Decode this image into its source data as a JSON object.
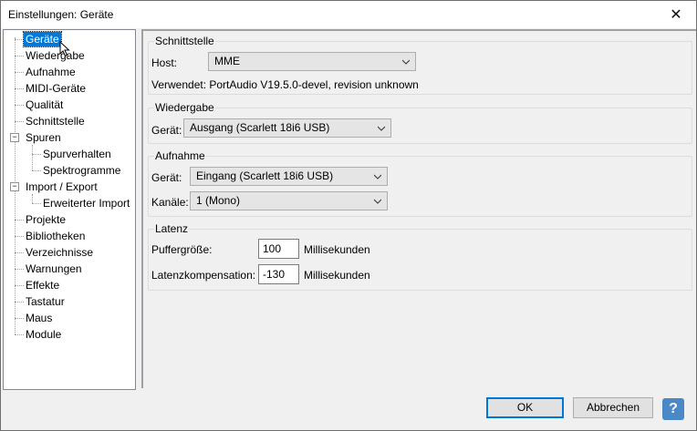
{
  "window": {
    "title": "Einstellungen: Geräte",
    "close_glyph": "✕"
  },
  "tree": {
    "items": [
      {
        "label": "Geräte"
      },
      {
        "label": "Wiedergabe"
      },
      {
        "label": "Aufnahme"
      },
      {
        "label": "MIDI-Geräte"
      },
      {
        "label": "Qualität"
      },
      {
        "label": "Schnittstelle"
      },
      {
        "label": "Spuren"
      },
      {
        "label": "Spurverhalten"
      },
      {
        "label": "Spektrogramme"
      },
      {
        "label": "Import / Export"
      },
      {
        "label": "Erweiterter Import"
      },
      {
        "label": "Projekte"
      },
      {
        "label": "Bibliotheken"
      },
      {
        "label": "Verzeichnisse"
      },
      {
        "label": "Warnungen"
      },
      {
        "label": "Effekte"
      },
      {
        "label": "Tastatur"
      },
      {
        "label": "Maus"
      },
      {
        "label": "Module"
      }
    ],
    "expander_glyph": "−"
  },
  "schnittstelle": {
    "title": "Schnittstelle",
    "host_label": "Host:",
    "host_value": "MME",
    "verwendet": "Verwendet: PortAudio V19.5.0-devel, revision unknown"
  },
  "wiedergabe": {
    "title": "Wiedergabe",
    "geraet_label": "Gerät:",
    "geraet_value": "Ausgang (Scarlett 18i6 USB)"
  },
  "aufnahme": {
    "title": "Aufnahme",
    "geraet_label": "Gerät:",
    "geraet_value": "Eingang (Scarlett 18i6 USB)",
    "kanaele_label": "Kanäle:",
    "kanaele_value": "1 (Mono)"
  },
  "latenz": {
    "title": "Latenz",
    "puffer_label": "Puffergröße:",
    "puffer_value": "100",
    "puffer_unit": "Millisekunden",
    "komp_label": "Latenzkompensation:",
    "komp_value": "-130",
    "komp_unit": "Millisekunden"
  },
  "buttons": {
    "ok": "OK",
    "cancel": "Abbrechen",
    "help": "?"
  }
}
